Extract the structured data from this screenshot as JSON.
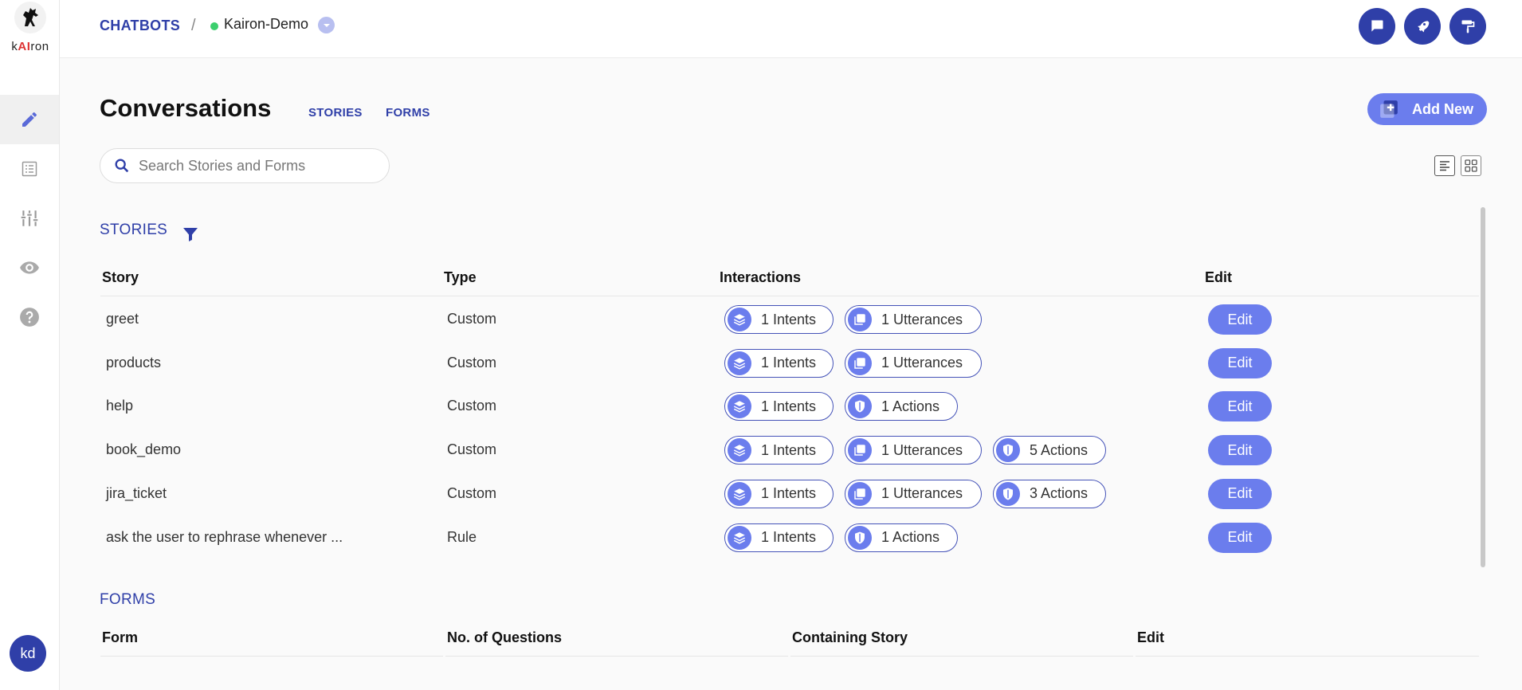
{
  "logo": {
    "text_prefix": "k",
    "text_ai": "AI",
    "text_suffix": "ron"
  },
  "breadcrumb": {
    "root": "CHATBOTS",
    "separator": "/",
    "bot_name": "Kairon-Demo",
    "status_color": "#3ccf6e"
  },
  "header_buttons": [
    "chat-icon",
    "rocket-icon",
    "paint-roller-icon"
  ],
  "sidebar": {
    "items": [
      "pencil-icon",
      "list-icon",
      "sliders-icon",
      "eye-icon",
      "help-icon"
    ],
    "avatar": "kd"
  },
  "page": {
    "title": "Conversations",
    "tabs": [
      "STORIES",
      "FORMS"
    ],
    "add_new_label": "Add New"
  },
  "search": {
    "placeholder": "Search Stories and Forms",
    "value": ""
  },
  "stories": {
    "title": "STORIES",
    "columns": [
      "Story",
      "Type",
      "Interactions",
      "Edit"
    ],
    "rows": [
      {
        "story": "greet",
        "type": "Custom",
        "pills": [
          {
            "kind": "intent",
            "label": "1 Intents"
          },
          {
            "kind": "utterance",
            "label": "1 Utterances"
          }
        ],
        "edit": "Edit"
      },
      {
        "story": "products",
        "type": "Custom",
        "pills": [
          {
            "kind": "intent",
            "label": "1 Intents"
          },
          {
            "kind": "utterance",
            "label": "1 Utterances"
          }
        ],
        "edit": "Edit"
      },
      {
        "story": "help",
        "type": "Custom",
        "pills": [
          {
            "kind": "intent",
            "label": "1 Intents"
          },
          {
            "kind": "action",
            "label": "1 Actions"
          }
        ],
        "edit": "Edit"
      },
      {
        "story": "book_demo",
        "type": "Custom",
        "pills": [
          {
            "kind": "intent",
            "label": "1 Intents"
          },
          {
            "kind": "utterance",
            "label": "1 Utterances"
          },
          {
            "kind": "action",
            "label": "5 Actions"
          }
        ],
        "edit": "Edit"
      },
      {
        "story": "jira_ticket",
        "type": "Custom",
        "pills": [
          {
            "kind": "intent",
            "label": "1 Intents"
          },
          {
            "kind": "utterance",
            "label": "1 Utterances"
          },
          {
            "kind": "action",
            "label": "3 Actions"
          }
        ],
        "edit": "Edit"
      },
      {
        "story": "ask the user to rephrase whenever ...",
        "type": "Rule",
        "pills": [
          {
            "kind": "intent",
            "label": "1 Intents"
          },
          {
            "kind": "action",
            "label": "1 Actions"
          }
        ],
        "edit": "Edit"
      }
    ]
  },
  "forms": {
    "title": "FORMS",
    "columns": [
      "Form",
      "No. of Questions",
      "Containing Story",
      "Edit"
    ]
  },
  "colors": {
    "primary": "#2f3fa8",
    "accent": "#6b7ded",
    "online": "#3ccf6e"
  }
}
